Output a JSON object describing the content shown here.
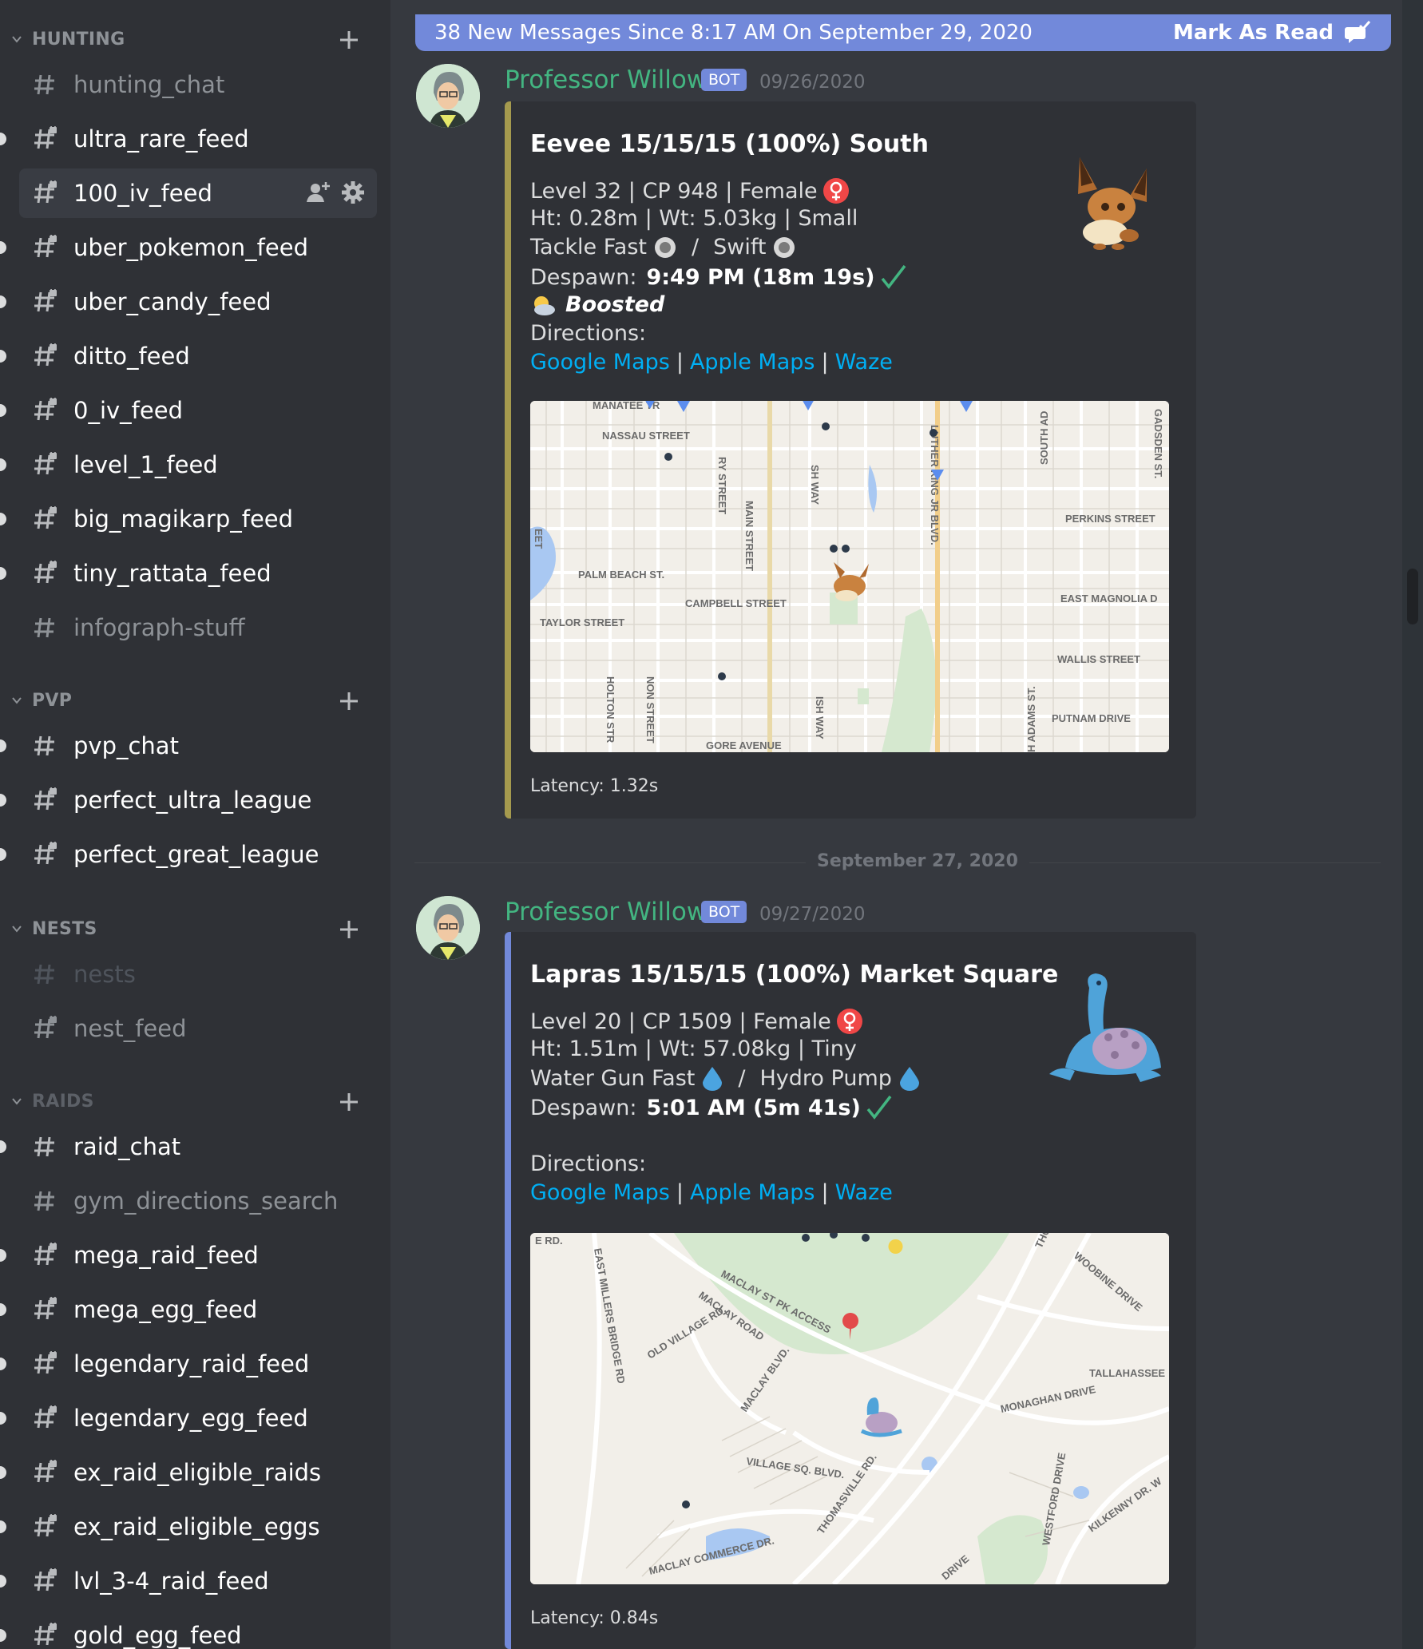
{
  "sidebar": {
    "categories": [
      {
        "label": "HUNTING",
        "channels": [
          {
            "name": "hunting_chat",
            "style": "read",
            "locked": false,
            "unread": false
          },
          {
            "name": "ultra_rare_feed",
            "style": "unread",
            "locked": true,
            "unread": true
          },
          {
            "name": "100_iv_feed",
            "style": "selected",
            "locked": true,
            "unread": false
          },
          {
            "name": "uber_pokemon_feed",
            "style": "unread",
            "locked": true,
            "unread": true
          },
          {
            "name": "uber_candy_feed",
            "style": "unread",
            "locked": true,
            "unread": true
          },
          {
            "name": "ditto_feed",
            "style": "unread",
            "locked": true,
            "unread": true
          },
          {
            "name": "0_iv_feed",
            "style": "unread",
            "locked": true,
            "unread": true
          },
          {
            "name": "level_1_feed",
            "style": "unread",
            "locked": true,
            "unread": true
          },
          {
            "name": "big_magikarp_feed",
            "style": "unread",
            "locked": true,
            "unread": true
          },
          {
            "name": "tiny_rattata_feed",
            "style": "unread",
            "locked": true,
            "unread": true
          },
          {
            "name": "infograph-stuff",
            "style": "read",
            "locked": false,
            "unread": false
          }
        ]
      },
      {
        "label": "PVP",
        "channels": [
          {
            "name": "pvp_chat",
            "style": "unread",
            "locked": false,
            "unread": true
          },
          {
            "name": "perfect_ultra_league",
            "style": "unread",
            "locked": true,
            "unread": true
          },
          {
            "name": "perfect_great_league",
            "style": "unread",
            "locked": true,
            "unread": true
          }
        ]
      },
      {
        "label": "NESTS",
        "channels": [
          {
            "name": "nests",
            "style": "muted",
            "locked": false,
            "unread": false
          },
          {
            "name": "nest_feed",
            "style": "read",
            "locked": true,
            "unread": false
          }
        ]
      },
      {
        "label": "RAIDS",
        "channels": [
          {
            "name": "raid_chat",
            "style": "unread",
            "locked": false,
            "unread": true
          },
          {
            "name": "gym_directions_search",
            "style": "read",
            "locked": false,
            "unread": false
          },
          {
            "name": "mega_raid_feed",
            "style": "unread",
            "locked": true,
            "unread": true
          },
          {
            "name": "mega_egg_feed",
            "style": "unread",
            "locked": true,
            "unread": true
          },
          {
            "name": "legendary_raid_feed",
            "style": "unread",
            "locked": true,
            "unread": true
          },
          {
            "name": "legendary_egg_feed",
            "style": "unread",
            "locked": true,
            "unread": true
          },
          {
            "name": "ex_raid_eligible_raids",
            "style": "unread",
            "locked": true,
            "unread": true
          },
          {
            "name": "ex_raid_eligible_eggs",
            "style": "unread",
            "locked": true,
            "unread": true
          },
          {
            "name": "lvl_3-4_raid_feed",
            "style": "unread",
            "locked": true,
            "unread": true
          },
          {
            "name": "gold_egg_feed",
            "style": "unread",
            "locked": true,
            "unread": true
          }
        ]
      }
    ]
  },
  "banner": {
    "text": "38 New Messages Since 8:17 AM On September 29, 2020",
    "action": "Mark As Read"
  },
  "divider": "September 27, 2020",
  "messages": [
    {
      "author": "Professor Willow.",
      "tag": "BOT",
      "timestamp": "09/26/2020",
      "accent": "#a59a4e",
      "title": "Eevee  15/15/15  (100%)  South",
      "line1": "Level 32  |  CP 948  |  Female",
      "line2": "Ht: 0.28m  |  Wt: 5.03kg  |  Small",
      "move_fast": "Tackle Fast",
      "move_charge": "Swift",
      "move_sep": "/",
      "despawn_label": "Despawn:",
      "despawn_value": "9:49 PM  (18m 19s)",
      "boosted": "Boosted",
      "directions": "Directions:",
      "links": [
        "Google Maps",
        "Apple Maps",
        "Waze"
      ],
      "link_sep": "|",
      "map_labels": [
        "MANATEE TR",
        "NASSAU STREET",
        "RY STREET",
        "SH WAY",
        "LUTHER KING JR BLVD.",
        "SOUTH AD",
        "GADSDEN ST.",
        "PERKINS STREET",
        "PALM BEACH ST.",
        "MAIN STREET",
        "CAMPBELL STREET",
        "EAST MAGNOLIA D",
        "TAYLOR STREET",
        "WALLIS STREET",
        "HOLTON STR",
        "NON STREET",
        "ISH WAY",
        "H ADAMS ST.",
        "PUTNAM DRIVE",
        "GORE AVENUE",
        "EET"
      ],
      "latency": "Latency: 1.32s"
    },
    {
      "author": "Professor Willow.",
      "tag": "BOT",
      "timestamp": "09/27/2020",
      "accent": "#7289da",
      "title": "Lapras  15/15/15  (100%)  Market Square",
      "line1": "Level 20  |  CP 1509  |  Female",
      "line2": "Ht: 1.51m  |  Wt: 57.08kg  |  Tiny",
      "move_fast": "Water Gun Fast",
      "move_charge": "Hydro Pump",
      "move_sep": "/",
      "despawn_label": "Despawn:",
      "despawn_value": "5:01 AM  (5m 41s)",
      "directions": "Directions:",
      "links": [
        "Google Maps",
        "Apple Maps",
        "Waze"
      ],
      "link_sep": "|",
      "map_labels": [
        "E RD.",
        "EAST MILLERS BRIDGE RD",
        "MACLAY ST PK ACCESS",
        "MACLAY ROAD",
        "OLD VILLAGE RD.",
        "MACLAY BLVD.",
        "VILLAGE SQ. BLVD.",
        "THOMASVILLE RD.",
        "MACLAY COMMERCE DR.",
        "THOMA",
        "WOOBINE DRIVE",
        "TALLAHASSEE",
        "MONAGHAN DRIVE",
        "WESTFORD DRIVE",
        "KILKENNY DR. W",
        "DRIVE"
      ],
      "latency": "Latency: 0.84s"
    }
  ],
  "icons": {
    "hash": "hash-icon",
    "locked_hash": "locked-hash-icon",
    "add_member": "add-member-icon",
    "gear": "gear-icon",
    "plus": "plus-icon",
    "chevron": "chevron-down-icon",
    "female": "female-icon",
    "check": "check-icon",
    "water": "water-drop-icon",
    "normal": "normal-type-icon",
    "weather": "partly-cloudy-icon",
    "mark_read": "mark-read-icon"
  },
  "colors": {
    "background": "#36393f",
    "sidebar": "#2f3136",
    "embed": "#2f3136",
    "bot_tag": "#7289da",
    "author": "#43b581",
    "link": "#00aff4",
    "check": "#43b581",
    "female": "#f04747"
  }
}
